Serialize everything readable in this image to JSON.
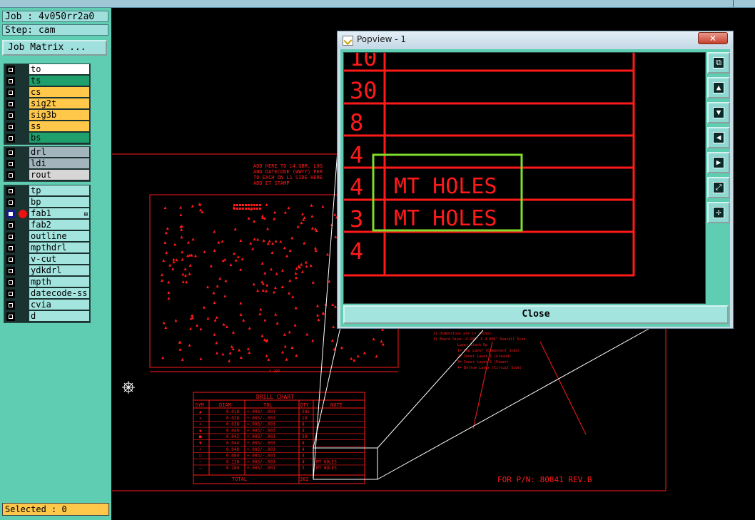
{
  "job": {
    "label": "Job : 4v050rr2a0",
    "step": "Step: cam",
    "matrix_button": "Job Matrix ..."
  },
  "layer_groups": [
    {
      "layers": [
        {
          "name": "to",
          "color": "white",
          "checked": false,
          "active": false
        },
        {
          "name": "ts",
          "color": "green",
          "checked": false,
          "active": false
        },
        {
          "name": "cs",
          "color": "orange",
          "checked": false,
          "active": false
        },
        {
          "name": "sig2t",
          "color": "orange",
          "checked": false,
          "active": false
        },
        {
          "name": "sig3b",
          "color": "orange",
          "checked": false,
          "active": false
        },
        {
          "name": "ss",
          "color": "orange",
          "checked": false,
          "active": false
        },
        {
          "name": "bs",
          "color": "green",
          "checked": false,
          "active": false
        }
      ]
    },
    {
      "layers": [
        {
          "name": "drl",
          "color": "grey",
          "checked": false,
          "active": false
        },
        {
          "name": "ldi",
          "color": "grey",
          "checked": false,
          "active": false
        },
        {
          "name": "rout",
          "color": "ltgrey",
          "checked": false,
          "active": false
        }
      ]
    },
    {
      "layers": [
        {
          "name": "tp",
          "color": "aqua",
          "checked": false,
          "active": false
        },
        {
          "name": "bp",
          "color": "aqua",
          "checked": false,
          "active": false
        },
        {
          "name": "fab1",
          "color": "aqua",
          "checked": true,
          "active": true
        },
        {
          "name": "fab2",
          "color": "aqua",
          "checked": false,
          "active": false
        },
        {
          "name": "outline",
          "color": "aqua",
          "checked": false,
          "active": false
        },
        {
          "name": "mpthdrl",
          "color": "aqua",
          "checked": false,
          "active": false
        },
        {
          "name": "v-cut",
          "color": "aqua",
          "checked": false,
          "active": false
        },
        {
          "name": "ydkdrl",
          "color": "aqua",
          "checked": false,
          "active": false
        },
        {
          "name": "mpth",
          "color": "aqua",
          "checked": false,
          "active": false
        },
        {
          "name": "datecode-ss",
          "color": "aqua",
          "checked": false,
          "active": false
        },
        {
          "name": "cvia",
          "color": "aqua",
          "checked": false,
          "active": false
        },
        {
          "name": "d",
          "color": "aqua",
          "checked": false,
          "active": false
        }
      ]
    }
  ],
  "status": {
    "selected": "Selected : 0"
  },
  "drawing": {
    "note_lines": [
      "ADD HERE TO L4.GBR, LOG",
      "AND DATECODE (WWYY) PER",
      "TO EACH ON L1 SIDE HERE",
      "ADD  ET  STAMP"
    ],
    "drill_chart": {
      "title": "DRILL  CHART",
      "headers": [
        "SYM",
        "DIAM",
        "TOL",
        "QTY",
        "NOTE"
      ],
      "rows": [
        [
          "▲",
          "0.018",
          "+.003/-.003",
          "285",
          ""
        ],
        [
          "×",
          "0.028",
          "+.003/-.003",
          "19",
          ""
        ],
        [
          "+",
          "0.038",
          "+.003/-.003",
          "8",
          ""
        ],
        [
          "◆",
          "0.040",
          "+.003/-.003",
          "4",
          ""
        ],
        [
          "■",
          "0.042",
          "+.003/-.003",
          "30",
          ""
        ],
        [
          "▼",
          "0.044",
          "+.003/-.003",
          "8",
          ""
        ],
        [
          "•",
          "0.048",
          "+.003/-.003",
          "4",
          ""
        ],
        [
          "○",
          "0.080",
          "+.003/-.003",
          "4",
          ""
        ],
        [
          "−",
          "0.128",
          "+.003/-.003",
          "4",
          "MT  HOLES"
        ],
        [
          "—",
          "0.180",
          "+.003/-.003",
          "3",
          "MT  HOLES"
        ]
      ],
      "total_label": "TOTAL",
      "total_value": "382"
    },
    "notes_block": [
      "2) Dimensions are in inches",
      "3) Board Size: 4.290\" X 4.090\" Overall Size",
      "Layer Stack Up",
      "1= Top Layer (Component Side)",
      "2= Inner Layer 1 (Ground)",
      "3= Inner Layer 2 (Power)",
      "4= Bottom Layer (Circuit Side)"
    ],
    "pn_text": "FOR P/N: 80841 REV.B",
    "dim_label": "4.290"
  },
  "popview": {
    "title": "Popview - 1",
    "close_x": "✕",
    "close_button": "Close",
    "rows": [
      {
        "qty": "10",
        "note": ""
      },
      {
        "qty": "30",
        "note": ""
      },
      {
        "qty": "8",
        "note": ""
      },
      {
        "qty": "4",
        "note": ""
      },
      {
        "qty": "4",
        "note": "MT  HOLES"
      },
      {
        "qty": "3",
        "note": "MT  HOLES"
      },
      {
        "qty": "4",
        "note": ""
      }
    ],
    "tools": [
      {
        "icon": "zoom-home-icon",
        "glyph": "⧉"
      },
      {
        "icon": "pan-up-icon",
        "glyph": "▲"
      },
      {
        "icon": "pan-down-icon",
        "glyph": "▼"
      },
      {
        "icon": "pan-left-icon",
        "glyph": "◀"
      },
      {
        "icon": "pan-right-icon",
        "glyph": "▶"
      },
      {
        "icon": "zoom-in-icon",
        "glyph": "⤢"
      },
      {
        "icon": "zoom-out-icon",
        "glyph": "✣"
      }
    ]
  },
  "colors": {
    "cad_red": "#ff1a1a",
    "highlight_green": "#7fdc2c",
    "panel_teal": "#5fcdb1"
  }
}
